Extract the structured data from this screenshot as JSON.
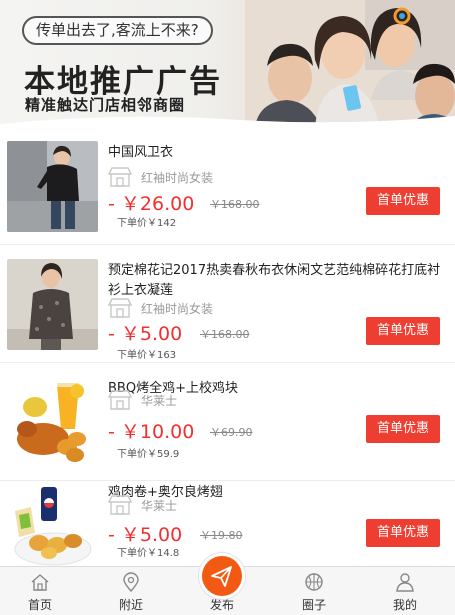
{
  "banner": {
    "tagline": "传单出去了,客流上不来?",
    "title": "本地推广广告",
    "subtitle": "精准触达门店相邻商圈"
  },
  "colors": {
    "accent": "#ee3e32",
    "price": "#f23030",
    "nav_active": "#f25a13"
  },
  "products": [
    {
      "name": "中国风卫衣",
      "shop": "红袖时尚女装",
      "price": "- ￥26.00",
      "original_price": "￥168.00",
      "sold": "下单价￥142",
      "button": "首单优惠",
      "image": "woman-hoodie-photo"
    },
    {
      "name": "预定棉花记2017热卖春秋布衣休闲文艺范纯棉碎花打底衬衫上衣凝莲",
      "shop": "红袖时尚女装",
      "price": "- ￥5.00",
      "original_price": "￥168.00",
      "sold": "下单价￥163",
      "button": "首单优惠",
      "image": "woman-floral-shirt-photo"
    },
    {
      "name": "BBQ烤全鸡+上校鸡块",
      "shop": "华莱士",
      "price": "- ￥10.00",
      "original_price": "￥69.90",
      "sold": "下单价￥59.9",
      "button": "首单优惠",
      "image": "fried-chicken-juice-photo"
    },
    {
      "name": "鸡肉卷+奥尔良烤翅",
      "shop": "华莱士",
      "price": "- ￥5.00",
      "original_price": "￥19.80",
      "sold": "下单价￥14.8",
      "button": "首单优惠",
      "image": "chicken-wrap-pepsi-photo"
    }
  ],
  "tabs": [
    {
      "label": "首页",
      "icon": "home-icon"
    },
    {
      "label": "附近",
      "icon": "location-pin-icon"
    },
    {
      "label": "发布",
      "icon": "paper-plane-icon"
    },
    {
      "label": "圈子",
      "icon": "basketball-icon"
    },
    {
      "label": "我的",
      "icon": "user-icon"
    }
  ]
}
